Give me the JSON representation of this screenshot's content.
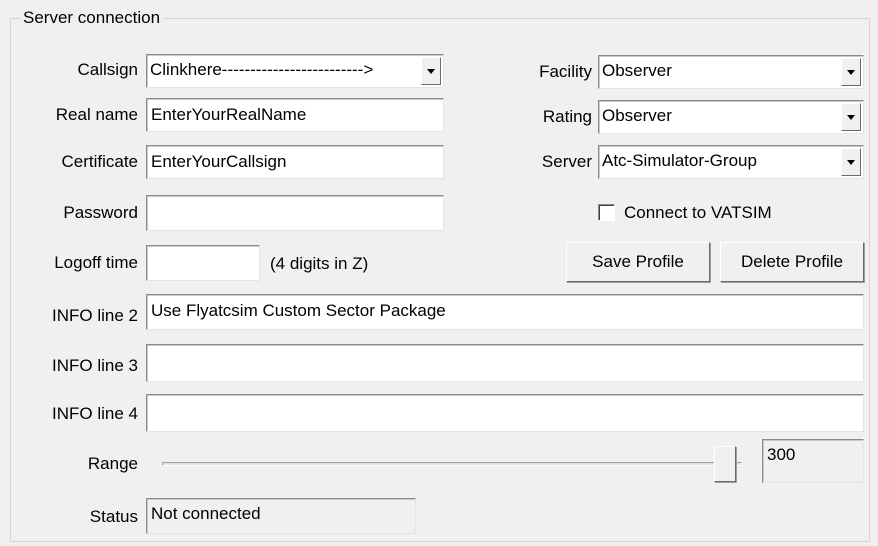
{
  "group_title": "Server connection",
  "labels": {
    "callsign": "Callsign",
    "real_name": "Real name",
    "certificate": "Certificate",
    "password": "Password",
    "logoff_time": "Logoff time",
    "logoff_hint": "(4 digits in Z)",
    "info2": "INFO line 2",
    "info3": "INFO line 3",
    "info4": "INFO line 4",
    "range": "Range",
    "status": "Status",
    "facility": "Facility",
    "rating": "Rating",
    "server": "Server"
  },
  "fields": {
    "callsign": "Clinkhere------------------------->",
    "real_name": "EnterYourRealName",
    "certificate": "EnterYourCallsign",
    "password": "",
    "logoff_time": "",
    "info2": "Use Flyatcsim Custom Sector Package",
    "info3": "",
    "info4": "",
    "range_value": "300",
    "status": "Not connected",
    "facility": "Observer",
    "rating": "Observer",
    "server": "Atc-Simulator-Group"
  },
  "range_level_fraction": 0.99,
  "connect_vatsim": {
    "label": "Connect to VATSIM",
    "checked": false
  },
  "buttons": {
    "save_profile": "Save Profile",
    "delete_profile": "Delete Profile"
  },
  "icons": {
    "combo_arrow": "chevron-down-icon"
  }
}
